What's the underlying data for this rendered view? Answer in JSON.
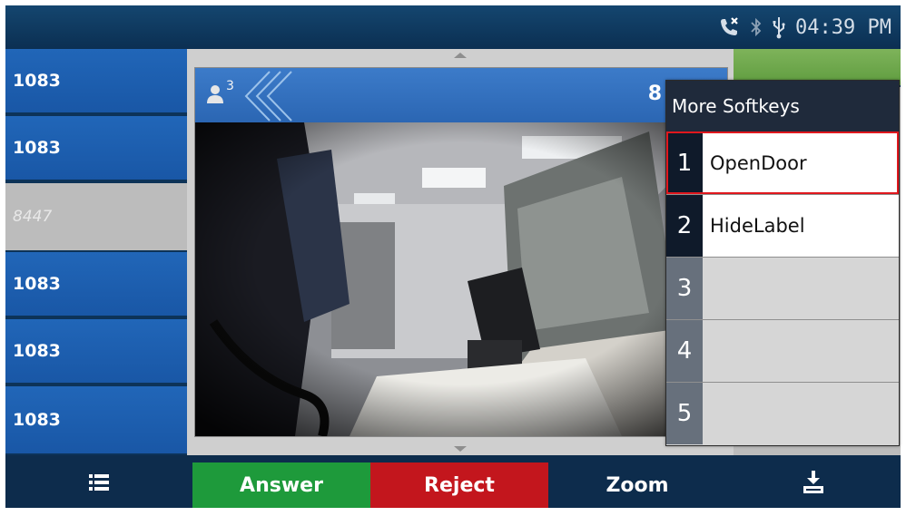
{
  "status_bar": {
    "time": "04:39 PM",
    "icons": [
      "missed-call-icon",
      "bluetooth-icon",
      "usb-icon"
    ]
  },
  "line_keys": [
    {
      "label": "1083",
      "state": "active"
    },
    {
      "label": "1083",
      "state": "active"
    },
    {
      "label": "8447",
      "state": "inactive"
    },
    {
      "label": "1083",
      "state": "active"
    },
    {
      "label": "1083",
      "state": "active"
    },
    {
      "label": "1083",
      "state": "active"
    }
  ],
  "call": {
    "conference_count": "3",
    "number_partial": "8"
  },
  "popup": {
    "title": "More Softkeys",
    "items": [
      {
        "num": "1",
        "label": "OpenDoor",
        "selected": true
      },
      {
        "num": "2",
        "label": "HideLabel"
      },
      {
        "num": "3",
        "label": ""
      },
      {
        "num": "4",
        "label": ""
      },
      {
        "num": "5",
        "label": ""
      }
    ]
  },
  "softkeys": {
    "menu_icon": "list-icon",
    "answer": "Answer",
    "reject": "Reject",
    "zoom": "Zoom",
    "more_icon": "download-tray-icon"
  },
  "colors": {
    "answer": "#1e9a3b",
    "reject": "#c3161d",
    "line_active": "#1f5fb0",
    "popup_selected_outline": "#e0171d"
  }
}
